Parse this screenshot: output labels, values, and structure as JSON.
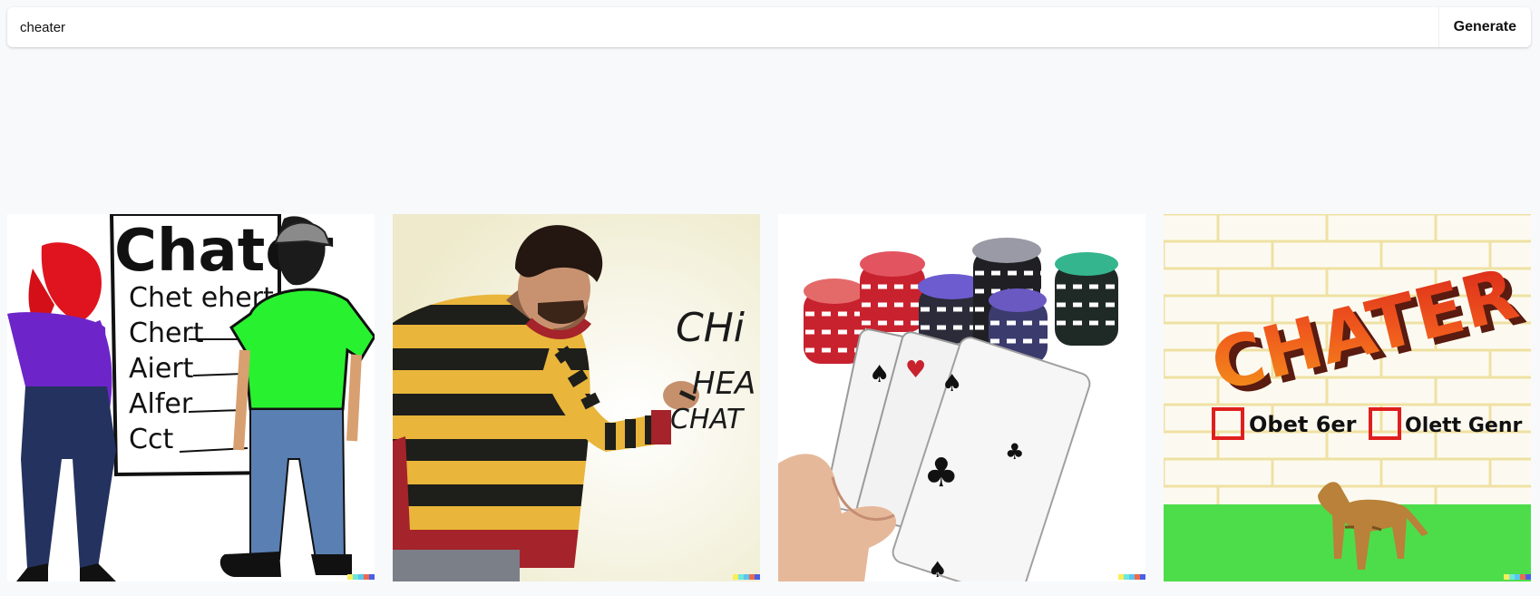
{
  "prompt": {
    "value": "cheater",
    "placeholder": ""
  },
  "generate_button": {
    "label": "Generate"
  },
  "images": [
    {
      "depiction": "cartoon couple facing a board",
      "board_title": "Chater",
      "board_lines": [
        "Chet ehert",
        "Chert",
        "Aiert",
        "Alfer",
        "Cct"
      ]
    },
    {
      "depiction": "man in striped sweater writing on a wall",
      "wall_lines": [
        "CHi",
        "HEA",
        "CHAT"
      ]
    },
    {
      "depiction": "hand holding playing cards with poker chips"
    },
    {
      "depiction": "brick wall sign with a dog",
      "sign_title": "CHATER",
      "option_labels": [
        "Obet 6er",
        "Olett Genr"
      ]
    }
  ],
  "colors": {
    "page_background": "#f8f9fb",
    "input_background": "#ffffff",
    "watermark": [
      "#f9ee56",
      "#6fe7dd",
      "#59c6ee",
      "#ec6a4f",
      "#4a5fe5"
    ]
  }
}
